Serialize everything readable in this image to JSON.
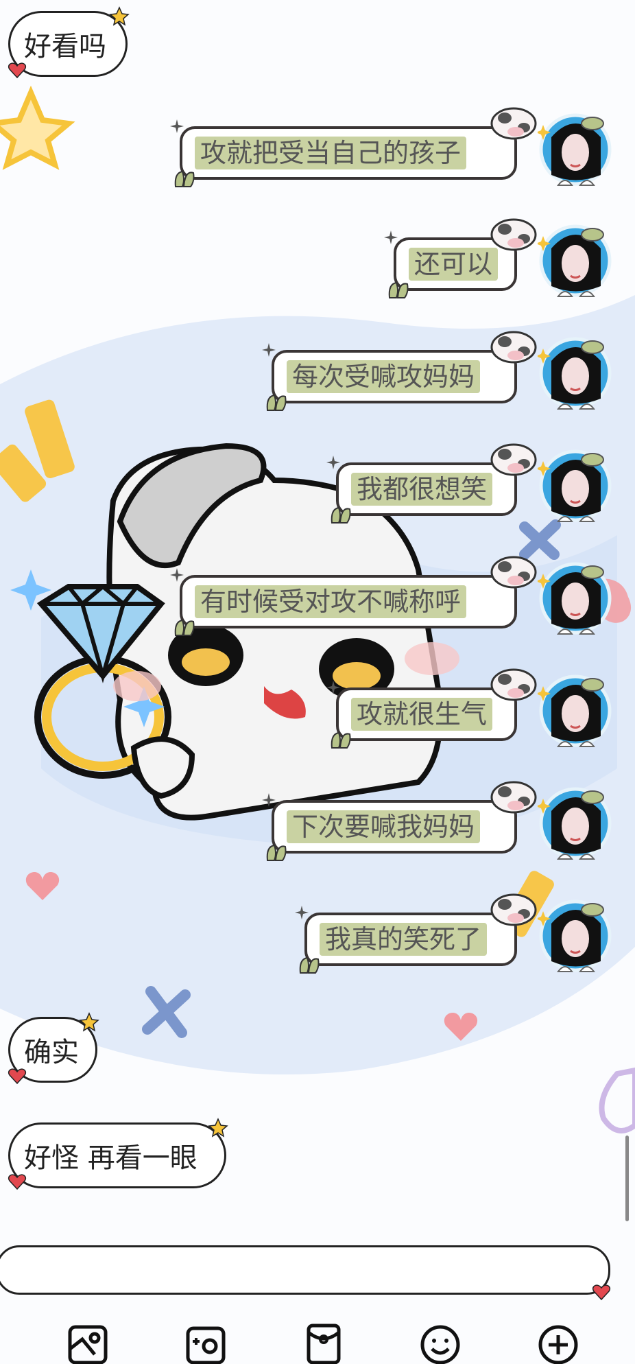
{
  "messages": [
    {
      "side": "left",
      "text": "好看吗"
    },
    {
      "side": "right",
      "text": "攻就把受当自己的孩子"
    },
    {
      "side": "right",
      "text": "还可以"
    },
    {
      "side": "right",
      "text": "每次受喊攻妈妈"
    },
    {
      "side": "right",
      "text": "我都很想笑"
    },
    {
      "side": "right",
      "text": "有时候受对攻不喊称呼"
    },
    {
      "side": "right",
      "text": "攻就很生气"
    },
    {
      "side": "right",
      "text": "下次要喊我妈妈"
    },
    {
      "side": "right",
      "text": "我真的笑死了"
    },
    {
      "side": "left",
      "text": "确实"
    },
    {
      "side": "left",
      "text": "好怪 再看一眼"
    }
  ],
  "input": {
    "value": "",
    "placeholder": ""
  },
  "toolbar": [
    "image-icon",
    "camera-icon",
    "red-packet-icon",
    "emoji-icon",
    "plus-icon"
  ],
  "colors": {
    "bubble_highlight": "#c9d2a2",
    "star": "#f6c43a",
    "heart": "#e2484f",
    "wallpaper_blue": "#dde8f7"
  }
}
